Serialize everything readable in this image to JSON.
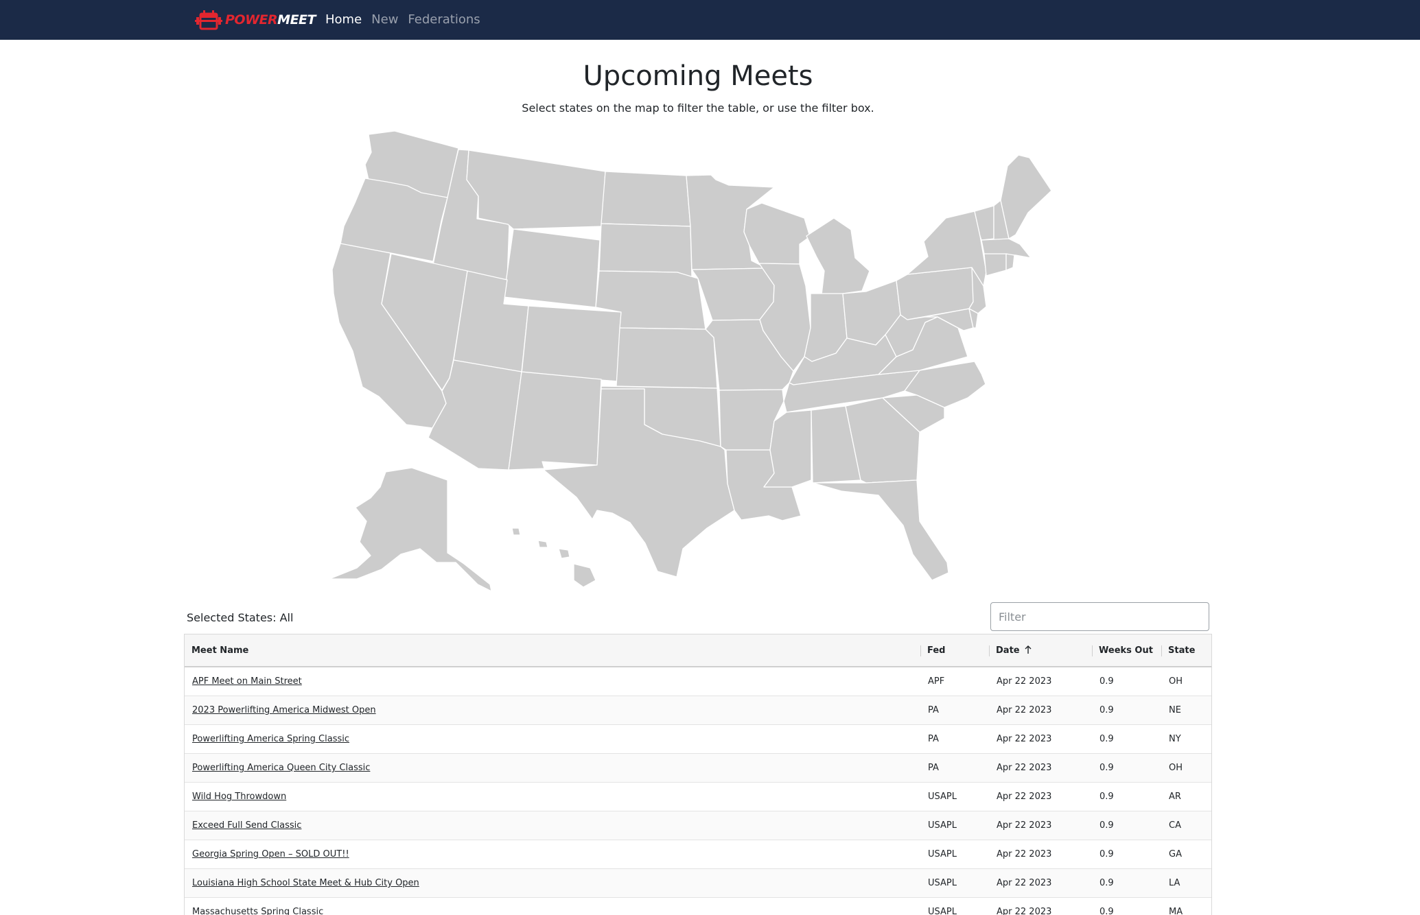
{
  "nav": {
    "brand_power": "POWER",
    "brand_meet": "MEET",
    "links": [
      {
        "label": "Home",
        "active": true
      },
      {
        "label": "New",
        "active": false
      },
      {
        "label": "Federations",
        "active": false
      }
    ]
  },
  "header": {
    "title": "Upcoming Meets",
    "subtitle": "Select states on the map to filter the table, or use the filter box."
  },
  "map": {
    "fill_color": "#cccccc",
    "stroke_color": "#ffffff"
  },
  "filter": {
    "selected_label": "Selected States: All",
    "placeholder": "Filter"
  },
  "table": {
    "columns": [
      "Meet Name",
      "Fed",
      "Date",
      "Weeks Out",
      "State"
    ],
    "sorted_column": "Date",
    "sort_direction": "ascending",
    "rows": [
      {
        "name": "APF Meet on Main Street",
        "fed": "APF",
        "date": "Apr 22 2023",
        "weeks": "0.9",
        "state": "OH"
      },
      {
        "name": "2023 Powerlifting America Midwest Open",
        "fed": "PA",
        "date": "Apr 22 2023",
        "weeks": "0.9",
        "state": "NE"
      },
      {
        "name": "Powerlifting America Spring Classic",
        "fed": "PA",
        "date": "Apr 22 2023",
        "weeks": "0.9",
        "state": "NY"
      },
      {
        "name": "Powerlifting America Queen City Classic",
        "fed": "PA",
        "date": "Apr 22 2023",
        "weeks": "0.9",
        "state": "OH"
      },
      {
        "name": "Wild Hog Throwdown",
        "fed": "USAPL",
        "date": "Apr 22 2023",
        "weeks": "0.9",
        "state": "AR"
      },
      {
        "name": "Exceed Full Send Classic",
        "fed": "USAPL",
        "date": "Apr 22 2023",
        "weeks": "0.9",
        "state": "CA"
      },
      {
        "name": "Georgia Spring Open – SOLD OUT!!",
        "fed": "USAPL",
        "date": "Apr 22 2023",
        "weeks": "0.9",
        "state": "GA"
      },
      {
        "name": "Louisiana High School State Meet & Hub City Open",
        "fed": "USAPL",
        "date": "Apr 22 2023",
        "weeks": "0.9",
        "state": "LA"
      },
      {
        "name": "Massachusetts Spring Classic",
        "fed": "USAPL",
        "date": "Apr 22 2023",
        "weeks": "0.9",
        "state": "MA"
      }
    ]
  }
}
